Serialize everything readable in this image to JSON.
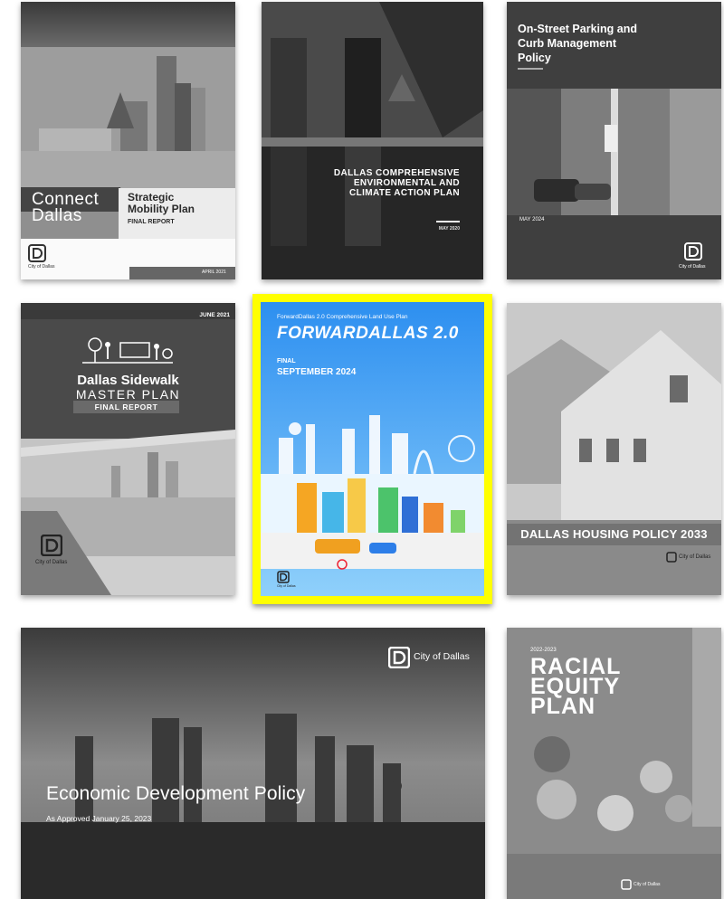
{
  "gallery": {
    "connect_dallas": {
      "logo_word_1": "Connect",
      "logo_word_2": "Dallas",
      "title": "Strategic Mobility Plan",
      "subtitle": "FINAL REPORT",
      "publisher": "City of Dallas",
      "date": "APRIL 2021"
    },
    "environmental": {
      "title_line_1": "DALLAS COMPREHENSIVE",
      "title_line_2": "ENVIRONMENTAL AND",
      "title_line_3": "CLIMATE ACTION PLAN",
      "date": "MAY 2020"
    },
    "parking": {
      "title_line_1": "On-Street Parking and",
      "title_line_2": "Curb Management",
      "title_line_3": "Policy",
      "date": "MAY 2024",
      "publisher": "City of Dallas"
    },
    "sidewalk": {
      "date": "JUNE 2021",
      "title_line_1": "Dallas Sidewalk",
      "title_line_2": "MASTER PLAN",
      "subtitle": "FINAL REPORT",
      "publisher": "City of Dallas"
    },
    "forward_dallas": {
      "subtitle": "ForwardDallas 2.0 Comprehensive Land Use Plan",
      "brand": "FORWARDALLAS 2.0",
      "status": "FINAL",
      "date": "SEPTEMBER 2024",
      "publisher": "City of Dallas",
      "highlight_color": "#ffff00",
      "sky_color": "#3aa0ee"
    },
    "housing": {
      "title": "DALLAS HOUSING POLICY 2033",
      "publisher": "City of Dallas"
    },
    "economic": {
      "publisher": "City of Dallas",
      "title": "Economic Development Policy",
      "subtitle": "As Approved January 25, 2023"
    },
    "racial_equity": {
      "year": "2022-2023",
      "title_line_1": "RACIAL",
      "title_line_2": "EQUITY",
      "title_line_3": "PLAN",
      "publisher": "City of Dallas"
    }
  }
}
